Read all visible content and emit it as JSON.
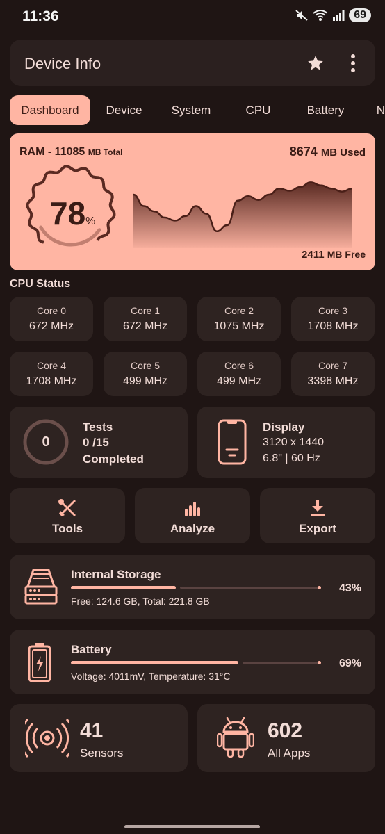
{
  "status_bar": {
    "time": "11:36",
    "battery": "69"
  },
  "app_bar": {
    "title": "Device Info",
    "icons": [
      "star-icon",
      "more-vert-icon"
    ]
  },
  "tabs": [
    {
      "label": "Dashboard",
      "active": true
    },
    {
      "label": "Device",
      "active": false
    },
    {
      "label": "System",
      "active": false
    },
    {
      "label": "CPU",
      "active": false
    },
    {
      "label": "Battery",
      "active": false
    },
    {
      "label": "N",
      "active": false
    }
  ],
  "ram": {
    "title": "RAM - 11085",
    "title_unit": "MB Total",
    "used_value": "8674",
    "used_unit": "MB Used",
    "free_value": "2411",
    "free_unit": "MB Free",
    "percent": "78",
    "percent_unit": "%",
    "usage_fraction": 0.78,
    "history": [
      0.7,
      0.55,
      0.48,
      0.4,
      0.36,
      0.42,
      0.55,
      0.45,
      0.22,
      0.3,
      0.62,
      0.68,
      0.63,
      0.7,
      0.78,
      0.75,
      0.8,
      0.86,
      0.82,
      0.78,
      0.74,
      0.78
    ]
  },
  "cpu": {
    "section_title": "CPU Status",
    "cores": [
      {
        "name": "Core 0",
        "freq": "672 MHz"
      },
      {
        "name": "Core 1",
        "freq": "672 MHz"
      },
      {
        "name": "Core 2",
        "freq": "1075 MHz"
      },
      {
        "name": "Core 3",
        "freq": "1708 MHz"
      },
      {
        "name": "Core 4",
        "freq": "1708 MHz"
      },
      {
        "name": "Core 5",
        "freq": "499 MHz"
      },
      {
        "name": "Core 6",
        "freq": "499 MHz"
      },
      {
        "name": "Core 7",
        "freq": "3398 MHz"
      }
    ]
  },
  "tests": {
    "count": "0",
    "label": "Tests",
    "progress": "0 /15",
    "status": "Completed"
  },
  "display": {
    "label": "Display",
    "resolution": "3120 x 1440",
    "details": "6.8\" | 60 Hz"
  },
  "actions": [
    {
      "label": "Tools",
      "icon": "tools-icon"
    },
    {
      "label": "Analyze",
      "icon": "analyze-icon"
    },
    {
      "label": "Export",
      "icon": "export-icon"
    }
  ],
  "storage": {
    "label": "Internal Storage",
    "detail": "Free: 124.6 GB,  Total: 221.8 GB",
    "percent": "43%",
    "fraction": 0.43
  },
  "battery": {
    "label": "Battery",
    "detail": "Voltage: 4011mV,  Temperature: 31°C",
    "percent": "69%",
    "fraction": 0.69
  },
  "sensors": {
    "count": "41",
    "label": "Sensors"
  },
  "apps": {
    "count": "602",
    "label": "All Apps"
  },
  "colors": {
    "accent": "#ffb5a3",
    "background": "#1f1514",
    "card": "#2e2321",
    "ram_dark": "#5a2a22"
  }
}
